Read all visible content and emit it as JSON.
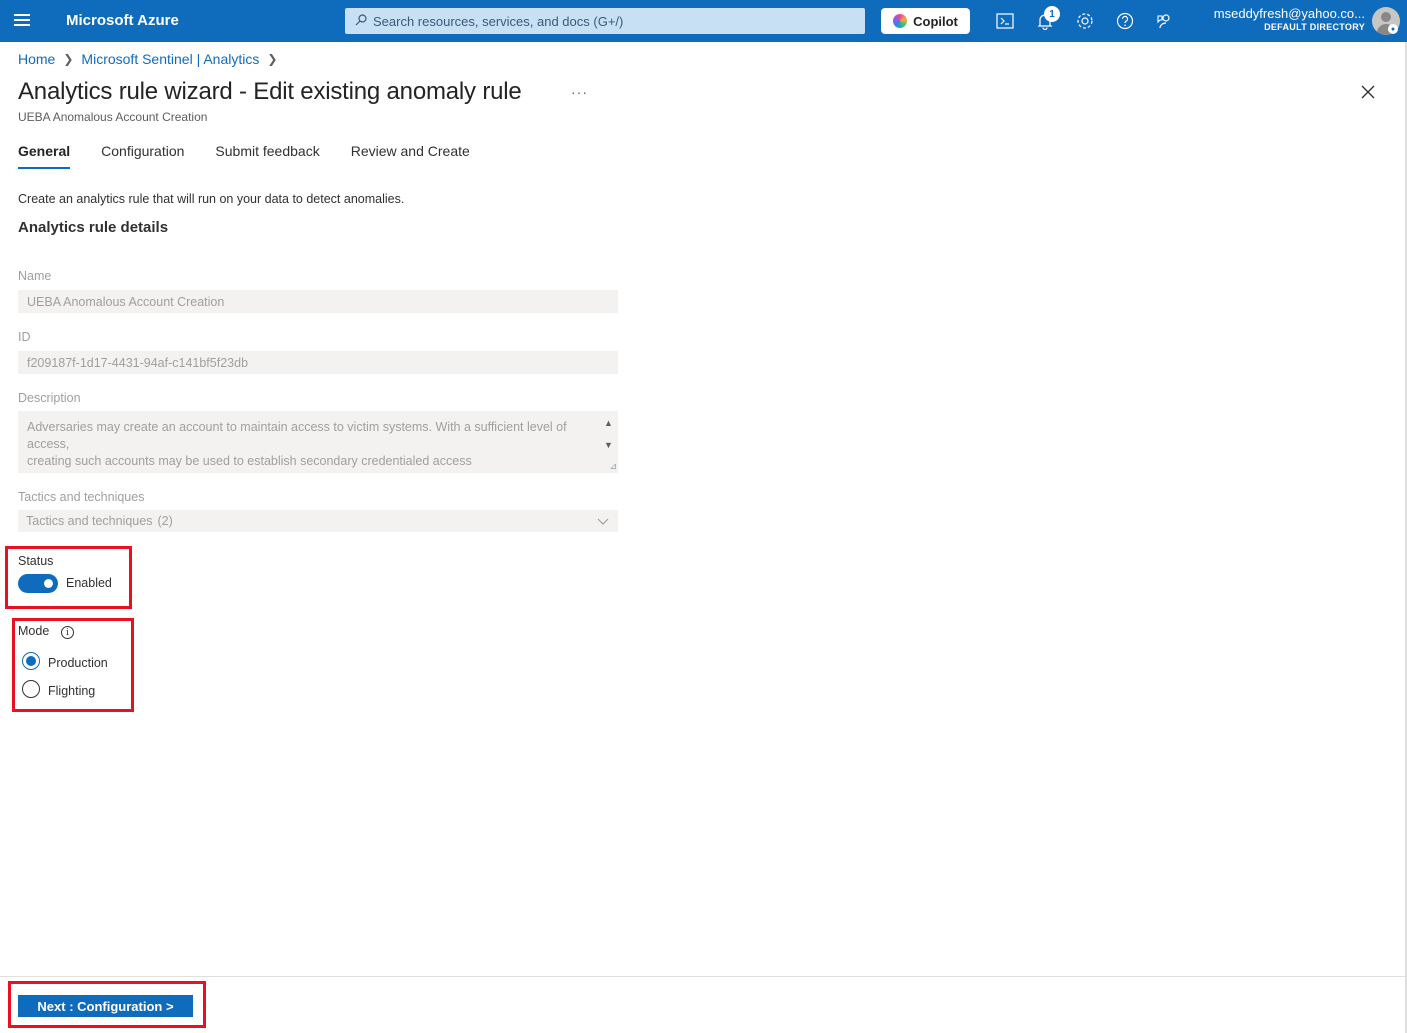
{
  "topbar": {
    "brand": "Microsoft Azure",
    "search_placeholder": "Search resources, services, and docs (G+/)",
    "copilot_label": "Copilot",
    "notification_count": "1",
    "account_email": "mseddyfresh@yahoo.co...",
    "account_directory": "DEFAULT DIRECTORY",
    "icons": [
      "menu-icon",
      "cloud-shell-icon",
      "notifications-icon",
      "settings-icon",
      "help-icon",
      "feedback-icon"
    ]
  },
  "breadcrumb": {
    "items": [
      "Home",
      "Microsoft Sentinel | Analytics"
    ]
  },
  "header": {
    "title": "Analytics rule wizard - Edit existing anomaly rule",
    "more": "···",
    "subtitle": "UEBA Anomalous Account Creation"
  },
  "tabs": [
    "General",
    "Configuration",
    "Submit feedback",
    "Review and Create"
  ],
  "general": {
    "intro": "Create an analytics rule that will run on your data to detect anomalies.",
    "section_title": "Analytics rule details",
    "name_label": "Name",
    "name_value": "UEBA Anomalous Account Creation",
    "id_label": "ID",
    "id_value": "f209187f-1d17-4431-94af-c141bf5f23db",
    "description_label": "Description",
    "description_line1": "Adversaries may create an account to maintain access to victim systems. With a sufficient level of access,",
    "description_line2": "creating such accounts may be used to establish secondary credentialed access",
    "tactics_label": "Tactics and techniques",
    "tactics_value": "Tactics and techniques",
    "tactics_count": "(2)",
    "status_label": "Status",
    "status_value": "Enabled",
    "mode_label": "Mode",
    "mode_options": [
      "Production",
      "Flighting"
    ],
    "mode_selected": "Production"
  },
  "footer": {
    "next_label": "Next : Configuration >"
  },
  "colors": {
    "accent": "#0f6cbd",
    "highlight_box": "#e81123"
  }
}
